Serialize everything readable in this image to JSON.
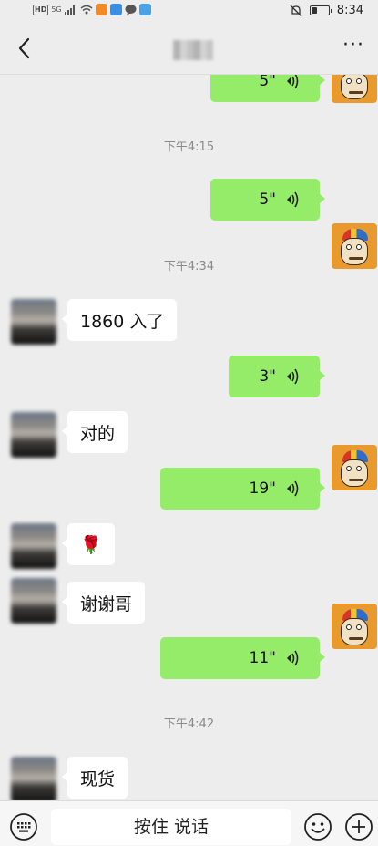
{
  "status_bar": {
    "hd": "HD",
    "signal": "5G",
    "time": "8:34",
    "battery_level": 0.35
  },
  "nav": {
    "back_icon": "back-arrow-icon",
    "more_label": "···"
  },
  "messages": {
    "m0": {
      "duration": "5\""
    },
    "t1": "下午4:15",
    "m1": {
      "duration": "5\""
    },
    "t2": "下午4:34",
    "m2": {
      "text": "1860 入了"
    },
    "m3": {
      "duration": "3\""
    },
    "m4": {
      "text": "对的"
    },
    "m5": {
      "duration": "19\""
    },
    "m6": {
      "text": "🌹"
    },
    "m7": {
      "text": "谢谢哥"
    },
    "m8": {
      "duration": "11\""
    },
    "t3": "下午4:42",
    "m9": {
      "text": "现货"
    }
  },
  "input_bar": {
    "hold_to_talk": "按住 说话",
    "keyboard_icon": "keyboard-icon",
    "emoji_icon": "emoji-icon",
    "plus_icon": "plus-icon"
  },
  "colors": {
    "sent_bubble": "#95ec69",
    "received_bubble": "#ffffff",
    "background": "#ededed"
  }
}
